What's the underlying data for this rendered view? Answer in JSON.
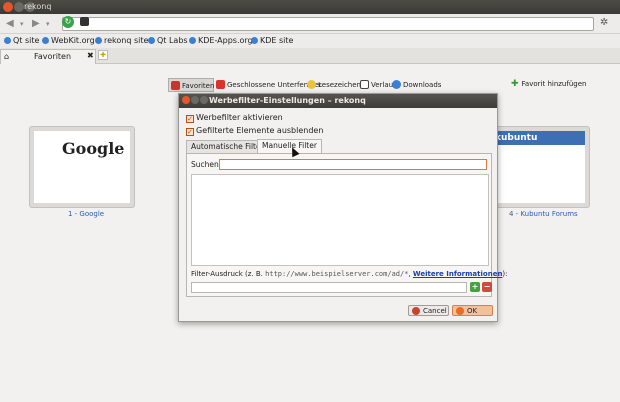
{
  "window": {
    "title": "rekonq"
  },
  "bookmarks": [
    {
      "label": "Qt site"
    },
    {
      "label": "WebKit.org"
    },
    {
      "label": "rekonq site"
    },
    {
      "label": "Qt Labs"
    },
    {
      "label": "KDE-Apps.org"
    },
    {
      "label": "KDE site"
    }
  ],
  "tab": {
    "label": "Favoriten"
  },
  "speedbar": {
    "favorites": "Favoriten",
    "closed": "Geschlossene Unterfenster",
    "bookmarks": "Lesezeichen",
    "history": "Verlauf",
    "downloads": "Downloads",
    "add_favorite": "Favorit hinzufügen"
  },
  "thumbnails": [
    {
      "label": "1 - Google",
      "text": "Google"
    },
    {
      "label": "4 - Kubuntu Forums",
      "text": "kubuntu"
    }
  ],
  "dialog": {
    "title": "Werbefilter-Einstellungen – rekonq",
    "enable_adblock": "Werbefilter aktivieren",
    "hide_filtered": "Gefilterte Elemente ausblenden",
    "tabs": [
      "Automatische Filter",
      "Manuelle Filter"
    ],
    "search_label": "Suchen:",
    "expr_prefix": "Filter-Ausdruck (z. B.",
    "expr_example": "http://www.beispielserver.com/ad/*",
    "expr_link": "Weitere Informationen",
    "expr_suffix": "):",
    "cancel": "Cancel",
    "ok": "OK"
  },
  "colors": {
    "accent": "#e07a3c",
    "titlebar": "#3e3d39",
    "link": "#2a5db0"
  }
}
